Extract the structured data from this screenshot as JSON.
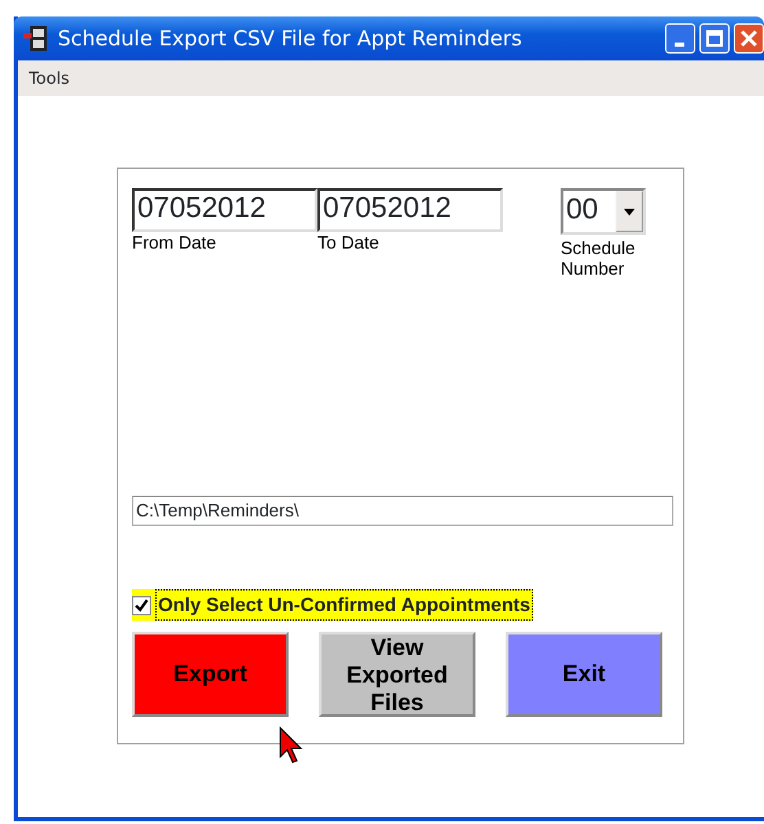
{
  "window": {
    "title": "Schedule Export CSV File for Appt Reminders"
  },
  "menu": [
    "Tools"
  ],
  "from_date": {
    "value": "07052012",
    "label": "From Date"
  },
  "to_date": {
    "value": "07052012",
    "label": "To Date"
  },
  "schedule": {
    "value": "00",
    "label": "Schedule Number"
  },
  "folder": {
    "value": "C:\\Temp\\Reminders\\"
  },
  "unconfirmed_only": {
    "label": "Only Select Un-Confirmed Appointments",
    "checked": true
  },
  "buttons": [
    {
      "label": "Export",
      "color": "#ff0000"
    },
    {
      "label": "View Exported Files",
      "color": "#c0c0c0"
    },
    {
      "label": "Exit",
      "color": "#8080ff"
    }
  ]
}
